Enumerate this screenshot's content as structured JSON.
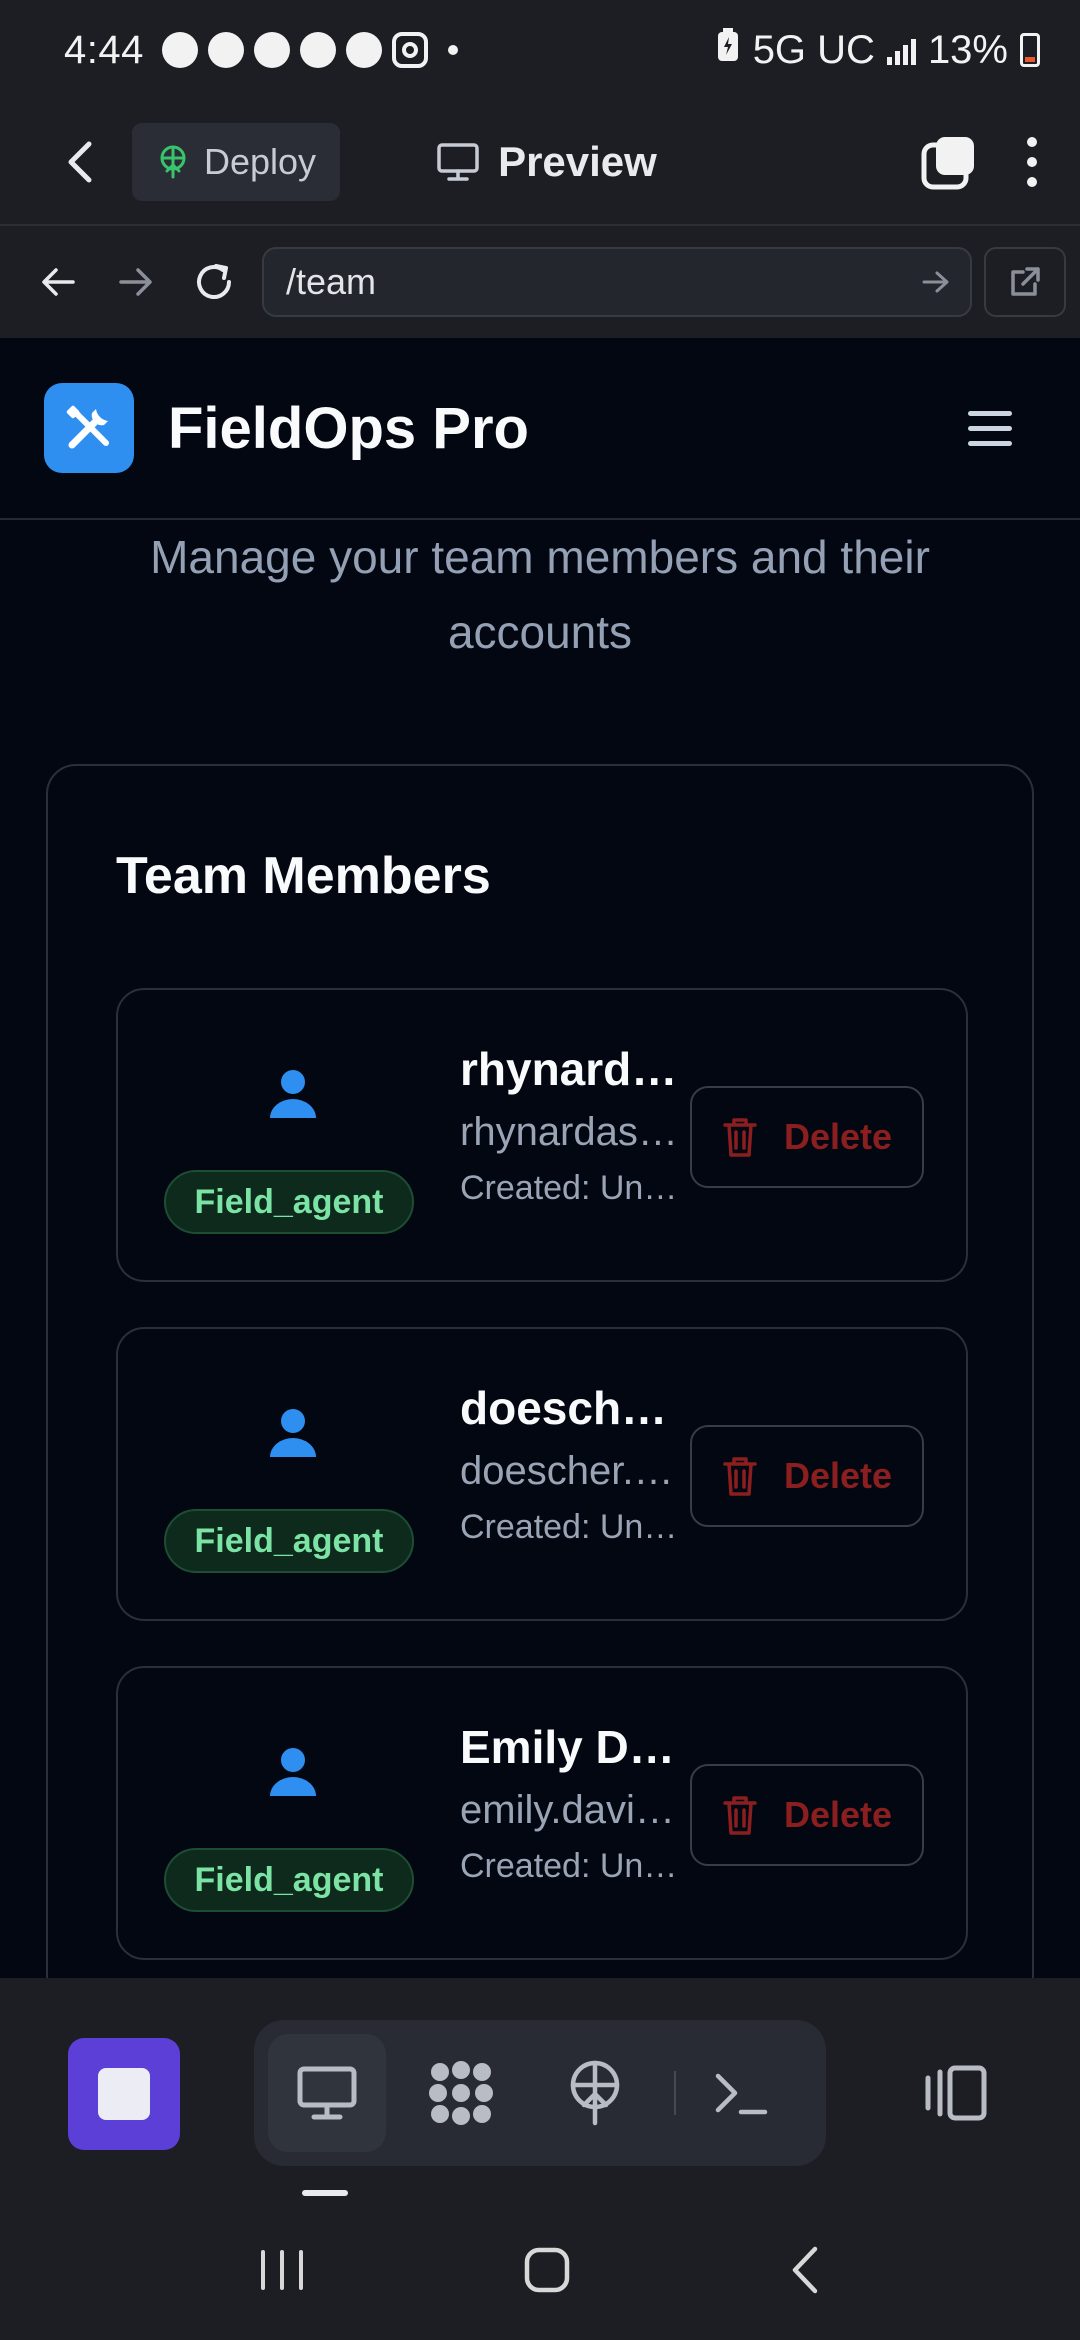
{
  "status_bar": {
    "time": "4:44",
    "network": "5G UC",
    "battery": "13%",
    "notification_icons": [
      "chat-icon",
      "messenger-icon",
      "messenger-icon",
      "messenger-icon",
      "messenger-icon",
      "instagram-icon",
      "dot-icon"
    ]
  },
  "app_toolbar": {
    "deploy_label": "Deploy",
    "preview_label": "Preview"
  },
  "url_bar": {
    "url": "/team"
  },
  "site": {
    "brand": "FieldOps Pro",
    "subtitle": "Manage your team members and their accounts",
    "card_title": "Team Members",
    "delete_label": "Delete",
    "members": [
      {
        "name": "rhynard…",
        "email": "rhynardas…",
        "created": "Created: Un…",
        "role": "Field_agent"
      },
      {
        "name": "doesche…",
        "email": "doescher.…",
        "created": "Created: Un…",
        "role": "Field_agent"
      },
      {
        "name": "Emily Da…",
        "email": "emily.davi…",
        "created": "Created: Un…",
        "role": "Field_agent"
      }
    ]
  },
  "ide_toolbar": {
    "tabs": [
      "preview-tab",
      "workspace-tab",
      "deploy-tab",
      "console-tab"
    ],
    "active_tab": "preview-tab"
  },
  "colors": {
    "accent_blue": "#2f8ff0",
    "stop_purple": "#5b3fd6",
    "badge_green": "#7be3a4",
    "delete_red": "#8b1f1f",
    "page_bg": "#030712"
  }
}
